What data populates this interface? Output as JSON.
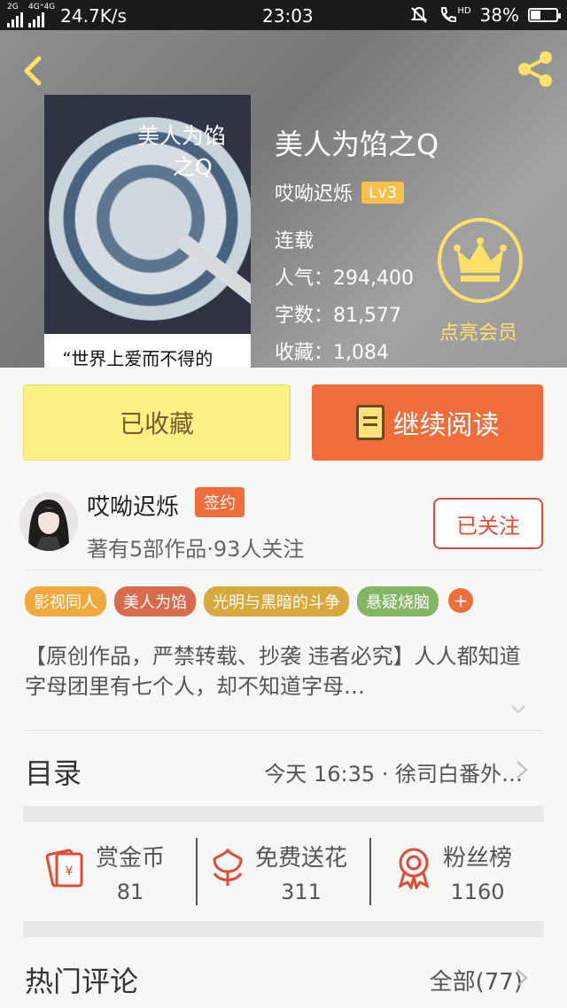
{
  "status_bar": {
    "net_top": "2G",
    "net_mid": "4G⁺4G",
    "speed": "24.7K/s",
    "time": "23:03",
    "hd": "HD",
    "battery": "38%",
    "battery_level": 0.38
  },
  "book": {
    "title": "美人为馅之Q",
    "author": "哎呦迟烁",
    "level": "Lv3",
    "status": "连载",
    "popularity_label": "人气：",
    "popularity": "294,400",
    "words_label": "字数：",
    "words": "81,577",
    "favorites_label": "收藏：",
    "favorites": "1,084",
    "cover_title_line1": "美人为馅",
    "cover_title_line2": "之Q",
    "cover_quote": "“世界上爱而不得的"
  },
  "vip": {
    "label": "点亮会员"
  },
  "actions": {
    "collect_label": "已收藏",
    "read_label": "继续阅读"
  },
  "author_card": {
    "name": "哎呦迟烁",
    "badge": "签约",
    "info": "著有5部作品·93人关注",
    "follow_label": "已关注"
  },
  "tags": [
    {
      "label": "影视同人",
      "color": "#f2a93b"
    },
    {
      "label": "美人为馅",
      "color": "#d96b4d"
    },
    {
      "label": "光明与黑暗的斗争",
      "color": "#d8a83c"
    },
    {
      "label": "悬疑烧脑",
      "color": "#82b564"
    }
  ],
  "tag_more": "+",
  "description": "【原创作品，严禁转载、抄袭  违者必究】人人都知道字母团里有七个人，却不知道字母…",
  "toc": {
    "label": "目录",
    "latest": "今天 16:35 · 徐司白番外…"
  },
  "stats": [
    {
      "label": "赏金币",
      "value": "81"
    },
    {
      "label": "免费送花",
      "value": "311"
    },
    {
      "label": "粉丝榜",
      "value": "1160"
    }
  ],
  "comments": {
    "label": "热门评论",
    "all": "全部(77)"
  },
  "colors": {
    "accent": "#ee6d3b",
    "vip": "#ffe069",
    "collect_bg": "#fbf185",
    "red": "#e04a37"
  }
}
